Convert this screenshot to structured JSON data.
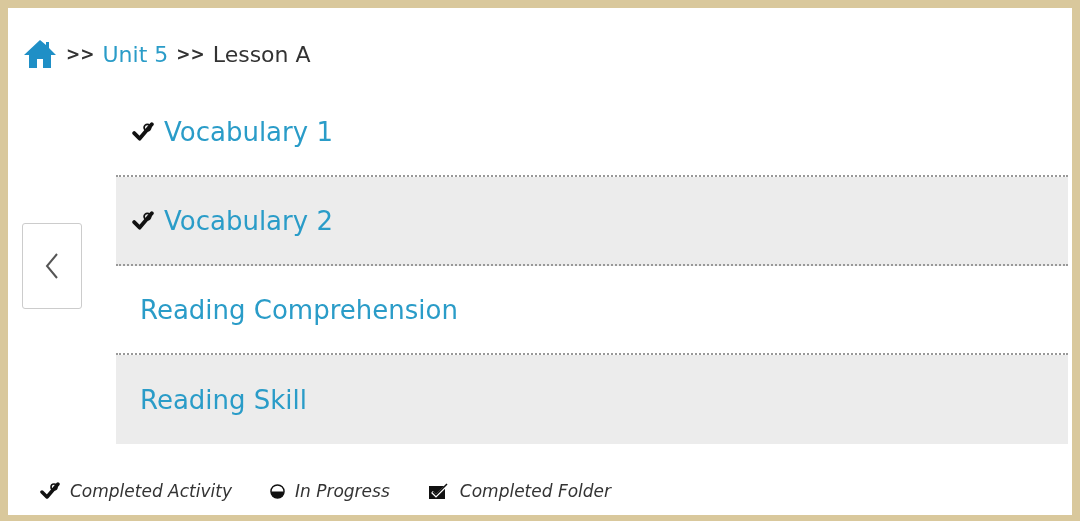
{
  "breadcrumb": {
    "separators": [
      ">>",
      ">>"
    ],
    "unit": "Unit 5",
    "lesson": "Lesson A"
  },
  "activities": [
    {
      "label": "Vocabulary 1",
      "completed": true
    },
    {
      "label": "Vocabulary 2",
      "completed": true
    },
    {
      "label": "Reading Comprehension",
      "completed": false
    },
    {
      "label": "Reading Skill",
      "completed": false
    }
  ],
  "legend": [
    {
      "kind": "completed",
      "label": "Completed Activity"
    },
    {
      "kind": "progress",
      "label": "In Progress"
    },
    {
      "kind": "folder",
      "label": "Completed Folder"
    }
  ]
}
